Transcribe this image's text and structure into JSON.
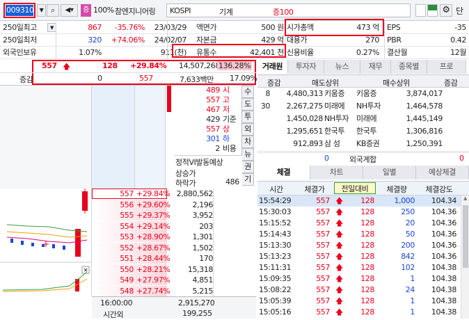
{
  "toolbar": {
    "code": "009310",
    "badge": "증",
    "pct": "100%",
    "name": "참엔지니어링",
    "market": "KOSPI",
    "kind": "기계",
    "margin": "증100",
    "unit": "단"
  },
  "info": {
    "rows": [
      {
        "l": "250일최고",
        "v1": "867",
        "v2": "-35.76%",
        "d": "23/03/29",
        "k": "액면가",
        "kv": "500 원",
        "k2": "시가총액",
        "kv2": "473 억",
        "k3": "EPS",
        "kv3": "-35"
      },
      {
        "l": "250일최저",
        "v1": "320",
        "v2": "+74.06%",
        "d": "24/02/07",
        "k": "자본금",
        "kv": "429 억",
        "k2": "대용가",
        "kv2": "270",
        "k3": "PBR",
        "kv3": "0.42"
      },
      {
        "l": "외국인보유",
        "v1": "1.07%",
        "v2": "",
        "d": "911(천)",
        "k": "유통수",
        "kv": "42,401 천",
        "k2": "신용비율",
        "kv2": "0.27%",
        "k3": "결산월",
        "kv3": "12월"
      }
    ]
  },
  "price": {
    "cur": "557",
    "chg": "128",
    "rate": "+29.84%",
    "vol": "14,507,268",
    "volrate": "136.28%",
    "l2": "증감",
    "zero": "0",
    "p2": "557",
    "amt": "7,633백만",
    "amt2": "17.09%"
  },
  "summary": [
    {
      "v": "489",
      "k": "시"
    },
    {
      "v": "557",
      "k": "고"
    },
    {
      "v": "467",
      "k": "저"
    },
    {
      "v": "429",
      "k": "기준"
    },
    {
      "v": "557",
      "k": "상"
    },
    {
      "v": "301",
      "k": "하"
    },
    {
      "v": "2",
      "k": "비용"
    }
  ],
  "vi": {
    "title": "정적VI발동예상",
    "up": "상승가",
    "down": "하락가",
    "downv": "486"
  },
  "sidebtns": [
    "수",
    "도",
    "투",
    "외",
    "차",
    "뉴",
    "권",
    "기"
  ],
  "book": [
    {
      "p": "557",
      "r": "+29.84%",
      "q": "2,880,562"
    },
    {
      "p": "556",
      "r": "+29.60%",
      "q": "2,196"
    },
    {
      "p": "555",
      "r": "+29.37%",
      "q": "3,952"
    },
    {
      "p": "554",
      "r": "+29.14%",
      "q": "203"
    },
    {
      "p": "553",
      "r": "+28.90%",
      "q": "1,301"
    },
    {
      "p": "552",
      "r": "+28.67%",
      "q": "1,502"
    },
    {
      "p": "551",
      "r": "+28.44%",
      "q": "170"
    },
    {
      "p": "550",
      "r": "+28.21%",
      "q": "15,318"
    },
    {
      "p": "549",
      "r": "+27.97%",
      "q": "4,851"
    },
    {
      "p": "548",
      "r": "+27.74%",
      "q": "5,215"
    }
  ],
  "bookfoot": {
    "time": "16:00:00",
    "total": "2,915,270",
    "after": "시간외",
    "aftv": "199,255"
  },
  "brokerTabs": [
    "거래원",
    "투자자",
    "뉴스",
    "재무",
    "종목별",
    "프로"
  ],
  "broker": {
    "h1": "증감",
    "h2": "매도상위",
    "h3": "매수상위",
    "h4": "증감",
    "rows": [
      {
        "a": "8",
        "b": "4,480,313",
        "c": "키움증",
        "d": "키움증",
        "e": "3,874,017",
        "f": ""
      },
      {
        "a": "30",
        "b": "2,267,275",
        "c": "미래에",
        "d": "NH투자",
        "e": "1,464,578",
        "f": ""
      },
      {
        "a": "",
        "b": "1,450,028",
        "c": "NH투자",
        "d": "미래에",
        "e": "1,445,149",
        "f": ""
      },
      {
        "a": "",
        "b": "1,295,651",
        "c": "한국투",
        "d": "한국투",
        "e": "1,306,816",
        "f": ""
      },
      {
        "a": "",
        "b": "912,893",
        "c": "삼 성",
        "d": "KB증권",
        "e": "1,250,391",
        "f": ""
      }
    ],
    "foot": {
      "a": "0",
      "c": "외국계합",
      "f": "0"
    }
  },
  "tradeTabs": [
    "체결",
    "차트",
    "일별",
    "예상체결"
  ],
  "trades": {
    "hdr": [
      "시간",
      "체결가",
      "전일대비",
      "체결량",
      "체결강도"
    ],
    "rows": [
      {
        "t": "15:54:29",
        "p": "557",
        "c": "128",
        "q": "1,000",
        "s": "104.34"
      },
      {
        "t": "15:30:03",
        "p": "557",
        "c": "128",
        "q": "250",
        "s": "104.36"
      },
      {
        "t": "15:15:52",
        "p": "557",
        "c": "128",
        "q": "20",
        "s": "104.36"
      },
      {
        "t": "15:14:43",
        "p": "557",
        "c": "128",
        "q": "50",
        "s": "104.36"
      },
      {
        "t": "15:13:30",
        "p": "557",
        "c": "128",
        "q": "200",
        "s": "104.36"
      },
      {
        "t": "15:13:23",
        "p": "557",
        "c": "128",
        "q": "842",
        "s": "104.36"
      },
      {
        "t": "15:11:31",
        "p": "557",
        "c": "128",
        "q": "102",
        "s": "104.38"
      },
      {
        "t": "15:09:35",
        "p": "557",
        "c": "128",
        "q": "1",
        "s": "104.38"
      },
      {
        "t": "15:08:22",
        "p": "557",
        "c": "128",
        "q": "24",
        "s": "104.38"
      },
      {
        "t": "15:05:39",
        "p": "557",
        "c": "128",
        "q": "1",
        "s": "104.38"
      },
      {
        "t": "15:05:16",
        "p": "557",
        "c": "128",
        "q": "1",
        "s": "104.38"
      }
    ]
  },
  "colors": {
    "up": "#e8001c",
    "down": "#1a44d8",
    "accent": "#1a5fd6"
  }
}
